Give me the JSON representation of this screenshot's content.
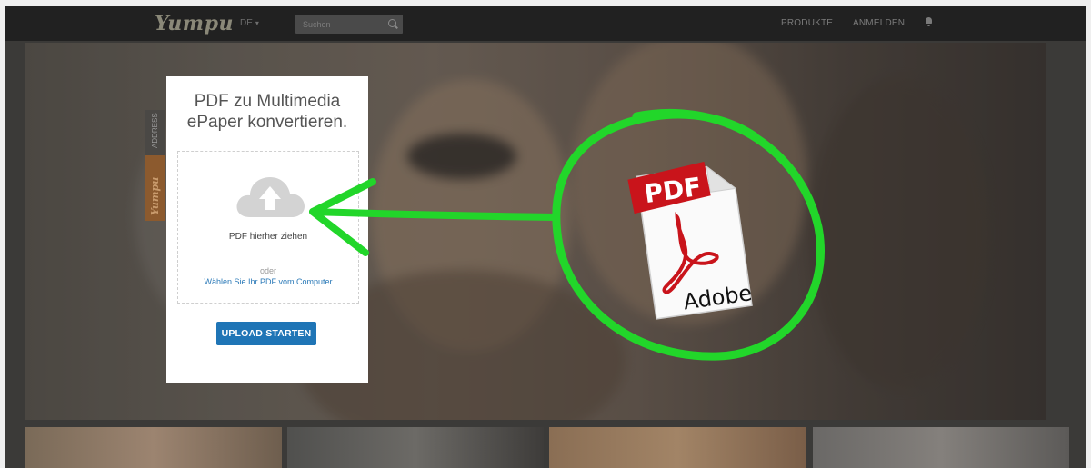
{
  "navbar": {
    "logo": "Yumpu",
    "language": "DE",
    "search_placeholder": "Suchen",
    "products_link": "PRODUKTE",
    "login_link": "ANMELDEN",
    "user_icon": "bell-icon"
  },
  "side_tab": {
    "label_top": "ADDRESS",
    "label_bottom": "Yumpu"
  },
  "upload_card": {
    "title_line1": "PDF zu Multimedia",
    "title_line2": "ePaper konvertieren.",
    "dropzone_icon": "cloud-upload-icon",
    "drop_label": "PDF hierher ziehen",
    "or_label": "oder",
    "choose_link": "Wählen Sie Ihr PDF vom Computer",
    "upload_button": "UPLOAD STARTEN"
  },
  "annotation": {
    "pdf_label": "PDF",
    "brand_label": "Adobe",
    "highlight_color": "#22d62a"
  },
  "colors": {
    "navbar_bg": "#212121",
    "button_blue": "#1f75b6",
    "link_blue": "#2b7ab8"
  }
}
